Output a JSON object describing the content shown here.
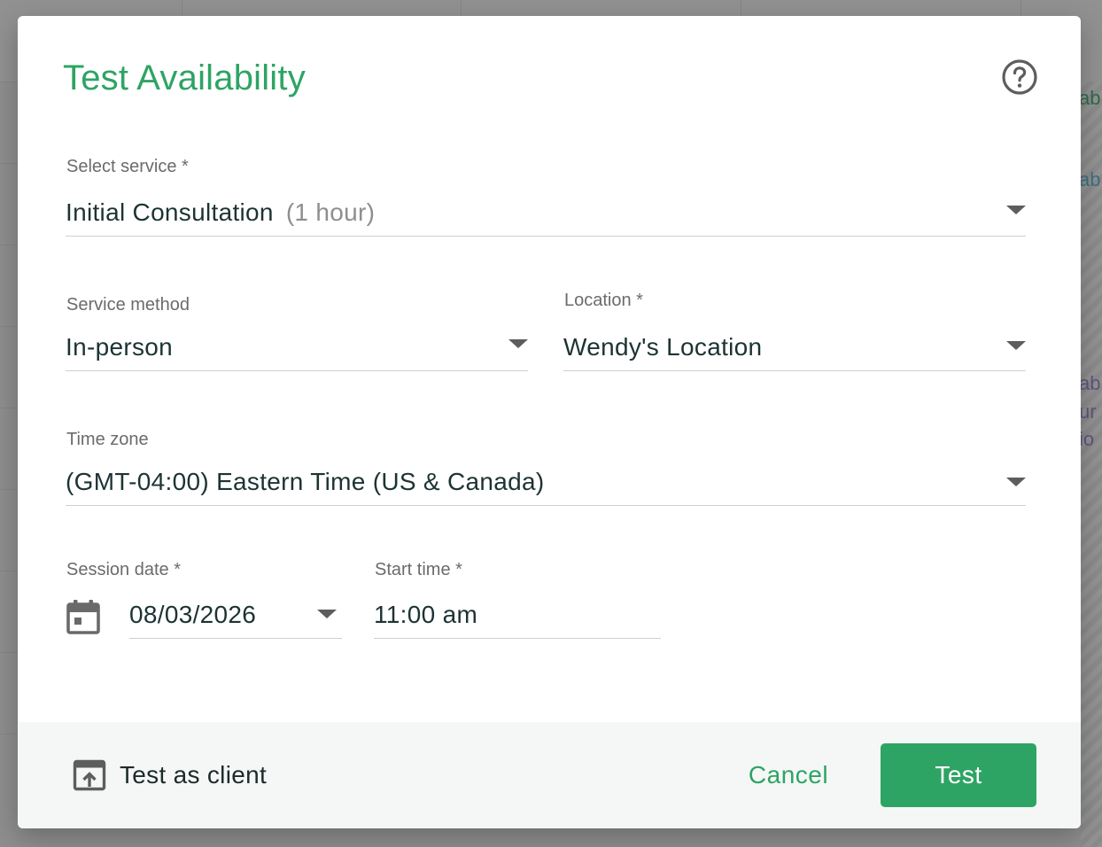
{
  "background": {
    "peek_texts": [
      "ab",
      "ab",
      "ab",
      "ur",
      "io"
    ],
    "colors": {
      "green": "#2e8a57",
      "teal": "#3a7f9a",
      "purple": "#7a62a8"
    }
  },
  "dialog": {
    "title": "Test Availability",
    "help_icon": "question-circle-icon",
    "fields": {
      "service": {
        "label": "Select service *",
        "value": "Initial Consultation",
        "hint": "(1 hour)"
      },
      "service_method": {
        "label": "Service method",
        "value": "In-person"
      },
      "location": {
        "label": "Location *",
        "value": "Wendy's Location"
      },
      "time_zone": {
        "label": "Time zone",
        "value": "(GMT-04:00) Eastern Time (US & Canada)"
      },
      "session_date": {
        "label": "Session date *",
        "value": "08/03/2026",
        "icon": "calendar-icon"
      },
      "start_time": {
        "label": "Start time *",
        "value": "11:00 am"
      }
    },
    "footer": {
      "test_as_client_label": "Test as client",
      "test_as_client_icon": "open-external-icon",
      "cancel_label": "Cancel",
      "test_label": "Test"
    }
  },
  "colors": {
    "accent": "#2ea464",
    "label": "#6b6b6b",
    "value": "#1d3333",
    "footer_bg": "#f5f7f6"
  }
}
